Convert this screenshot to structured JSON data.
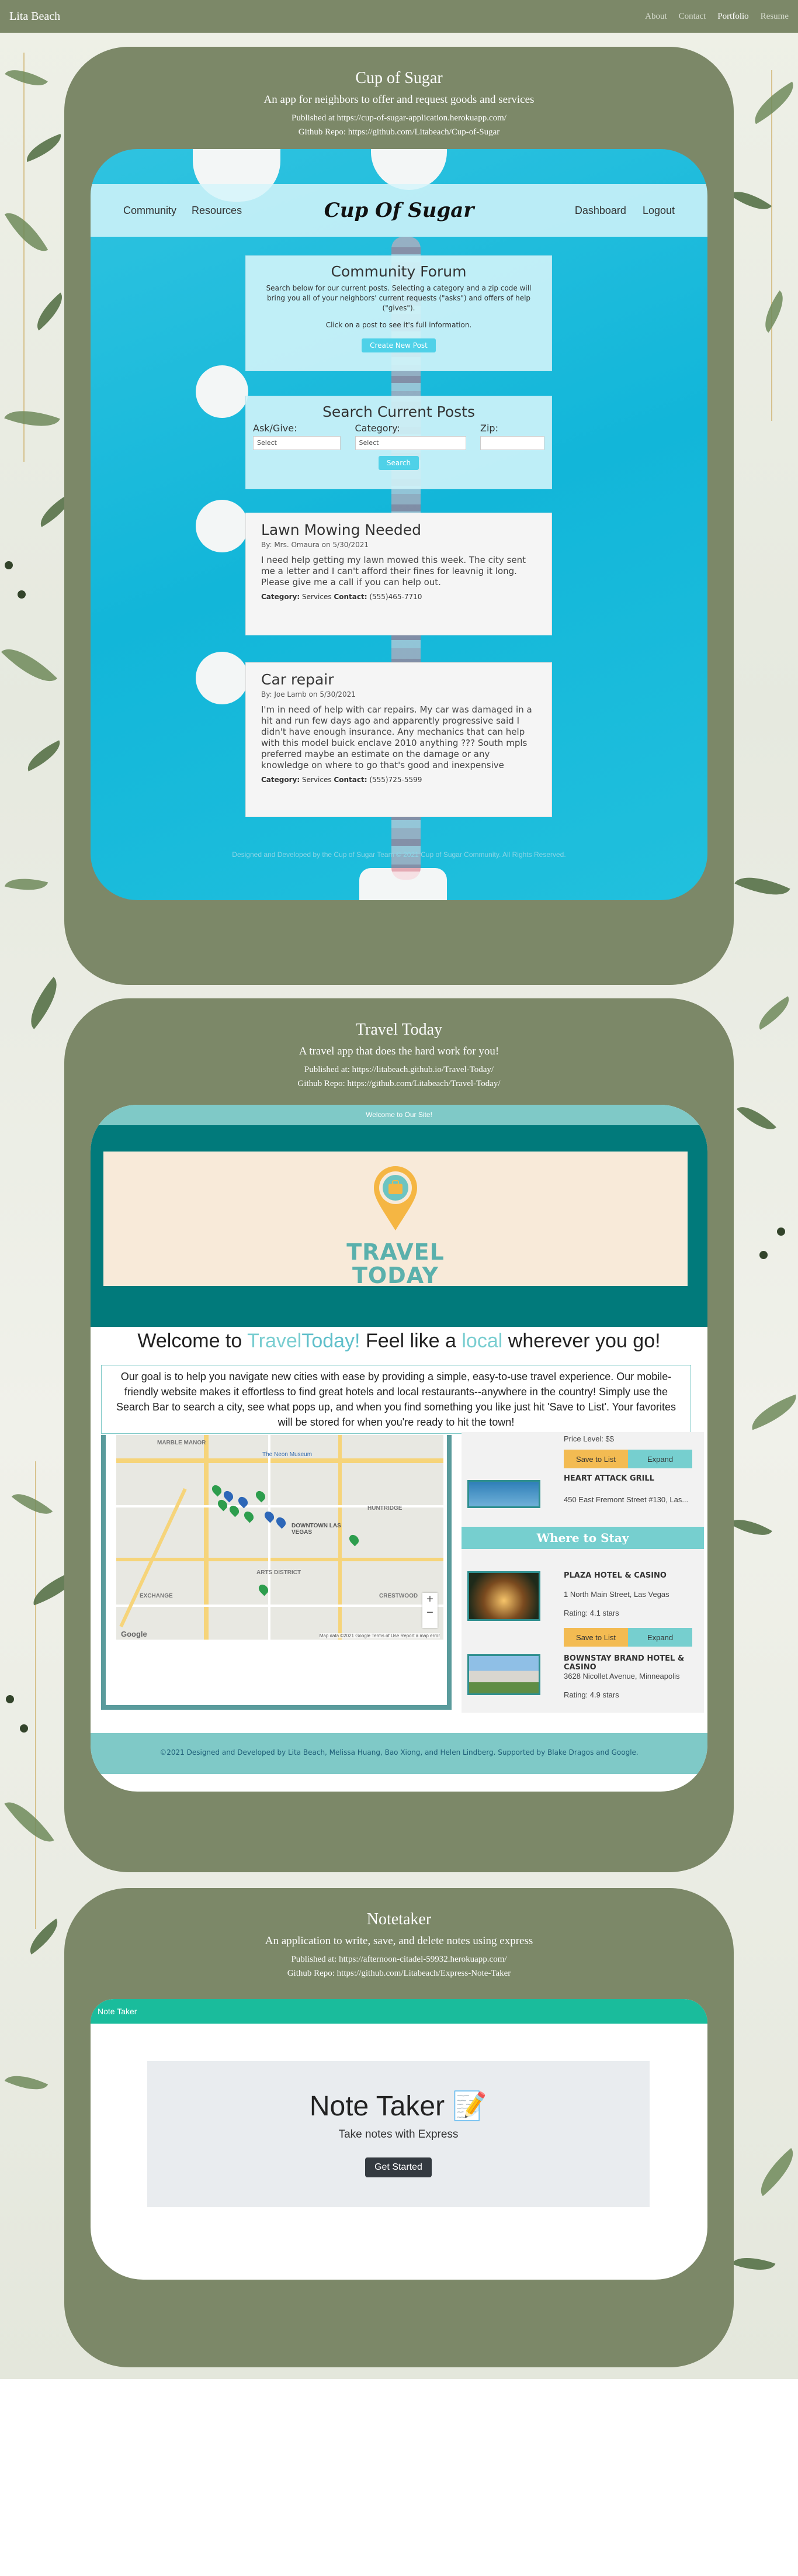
{
  "nav": {
    "brand": "Lita Beach",
    "links": [
      "About",
      "Contact",
      "Portfolio",
      "Resume"
    ]
  },
  "projects": [
    {
      "title": "Cup of Sugar",
      "subtitle": "An app for neighbors to offer and request goods and services",
      "published": "Published at https://cup-of-sugar-application.herokuapp.com/",
      "repo": "Github Repo: https://github.com/Litabeach/Cup-of-Sugar"
    },
    {
      "title": "Travel Today",
      "subtitle": "A travel app that does the hard work for you!",
      "published": "Published at: https://litabeach.github.io/Travel-Today/",
      "repo": "Github Repo: https://github.com/Litabeach/Travel-Today/"
    },
    {
      "title": "Notetaker",
      "subtitle": "An application to write, save, and delete notes using express",
      "published": "Published at: https://afternoon-citadel-59932.herokuapp.com/",
      "repo": "Github Repo: https://github.com/Litabeach/Express-Note-Taker"
    }
  ],
  "cup_of_sugar": {
    "nav_left": [
      "Community",
      "Resources"
    ],
    "logo": "Cup Of Sugar",
    "nav_right": [
      "Dashboard",
      "Logout"
    ],
    "forum": {
      "title": "Community Forum",
      "text1": "Search below for our current posts. Selecting a category and a zip code will bring you all of your neighbors' current requests (\"asks\") and offers of help (\"gives\").",
      "text2": "Click on a post to see it's full information.",
      "button": "Create New Post"
    },
    "search": {
      "title": "Search Current Posts",
      "ask_label": "Ask/Give:",
      "category_label": "Category:",
      "zip_label": "Zip:",
      "select_placeholder": "Select",
      "button": "Search"
    },
    "posts": [
      {
        "title": "Lawn Mowing Needed",
        "by": "By: Mrs. Omaura on 5/30/2021",
        "body": "I need help getting my lawn mowed this week. The city sent me a letter and I can't afford their fines for leavnig it long. Please give me a call if you can help out.",
        "category_label": "Category:",
        "category": "Services",
        "contact_label": "Contact:",
        "contact": "(555)465-7710"
      },
      {
        "title": "Car repair",
        "by": "By: Joe Lamb on 5/30/2021",
        "body": "I'm in need of help with car repairs. My car was damaged in a hit and run few days ago and apparently progressive said I didn't have enough insurance. Any mechanics that can help with this model buick enclave 2010 anything ??? South mpls preferred maybe an estimate on the damage or any knowledge on where to go that's good and inexpensive",
        "category_label": "Category:",
        "category": "Services",
        "contact_label": "Contact:",
        "contact": "(555)725-5599"
      }
    ],
    "footer": "Designed and Developed by the Cup of Sugar Team © 2021 Cup of Sugar Community. All Rights Reserved."
  },
  "travel_today": {
    "top_bar": "Welcome to Our Site!",
    "logo_word1": "TRAVEL",
    "logo_word2": "TODAY",
    "welcome_prefix": "Welcome to ",
    "welcome_brand1": "Travel",
    "welcome_brand2": "Today!",
    "welcome_mid": " Feel like a ",
    "welcome_local": "local",
    "welcome_suffix": " wherever you go!",
    "intro": "Our goal is to help you navigate new cities with ease by providing a simple, easy-to-use travel experience. Our mobile-friendly website makes it effortless to find great hotels and local restaurants--anywhere in the country! Simply use the Search Bar to search a city, see what pops up, and when you find something you like just hit 'Save to List'. Your favorites will be stored for when you're ready to hit the town!",
    "map": {
      "google": "Google",
      "credits": "Map data ©2021 Google  Terms of Use  Report a map error",
      "zoom_in": "+",
      "zoom_out": "−",
      "labels": [
        "MARBLE MANOR",
        "The Neon Museum",
        "HUNTRIDGE",
        "DOWNTOWN LAS VEGAS",
        "ARTS DISTRICT",
        "EXCHANGE",
        "CRESTWOOD"
      ]
    },
    "restaurants": [
      {
        "price": "Price Level: $$",
        "name": "HEART ATTACK GRILL",
        "address": "450 East Fremont Street #130, Las..."
      }
    ],
    "where_to_stay": "Where to Stay",
    "hotels": [
      {
        "name": "PLAZA HOTEL & CASINO",
        "address": "1 North Main Street, Las Vegas",
        "rating": "Rating: 4.1 stars"
      },
      {
        "name": "BOWNSTAY BRAND HOTEL & CASINO",
        "address": "3628 Nicollet Avenue, Minneapolis",
        "rating": "Rating: 4.9 stars"
      }
    ],
    "save_label": "Save to List",
    "expand_label": "Expand",
    "footer": "©2021 Designed and Developed by Lita Beach, Melissa Huang, Bao Xiong, and Helen Lindberg. Supported by Blake Dragos and Google."
  },
  "note_taker": {
    "bar": "Note Taker",
    "title": "Note Taker 📝",
    "lead": "Take notes with Express",
    "button": "Get Started"
  }
}
